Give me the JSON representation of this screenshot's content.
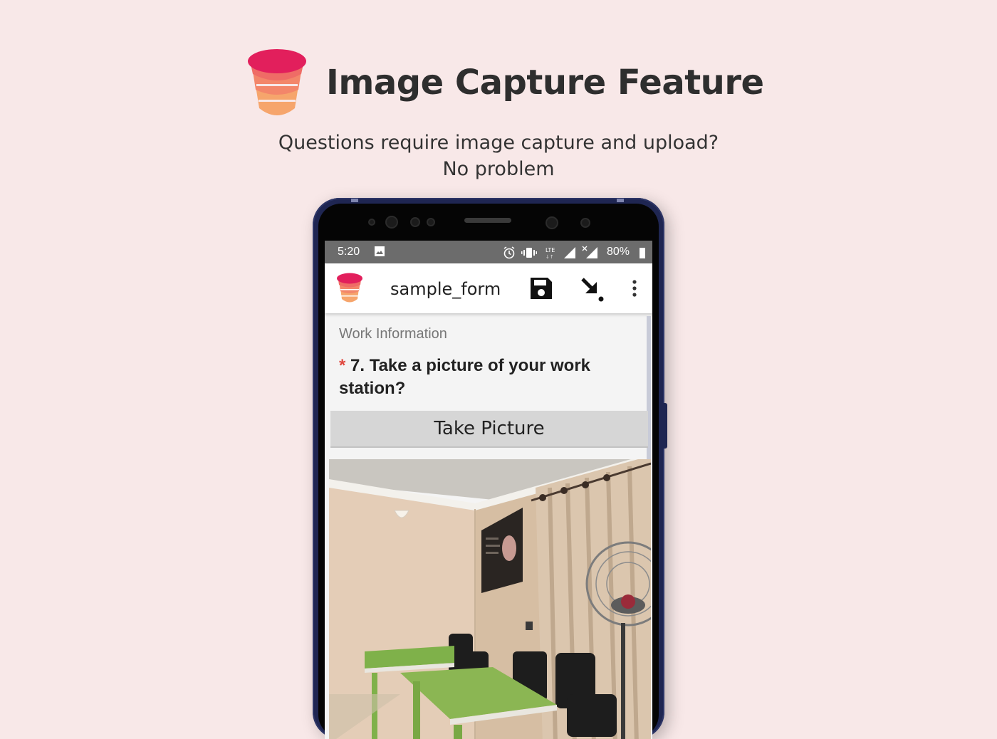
{
  "hero": {
    "title": "Image Capture Feature",
    "subtitle_line1": "Questions require image capture and upload?",
    "subtitle_line2": "No problem"
  },
  "status_bar": {
    "time": "5:20",
    "network": "LTE",
    "battery": "80%",
    "icons": [
      "image-icon",
      "alarm-icon",
      "vibrate-icon",
      "signal-icon",
      "signal-x-icon",
      "battery-icon"
    ]
  },
  "app_bar": {
    "title": "sample_form",
    "icons": [
      "app-logo",
      "save-icon",
      "go-to-icon",
      "more-vert-icon"
    ]
  },
  "form": {
    "section_title": "Work Information",
    "required_marker": "*",
    "question": "7. Take a picture of your work station?",
    "take_picture_label": "Take Picture"
  },
  "colors": {
    "background": "#f8e8e8",
    "logo_top": "#e21f5c",
    "logo_mid": "#f06a5f",
    "logo_bottom": "#f6a56c",
    "phone_frame": "#1f2652",
    "required": "#e0483f"
  }
}
